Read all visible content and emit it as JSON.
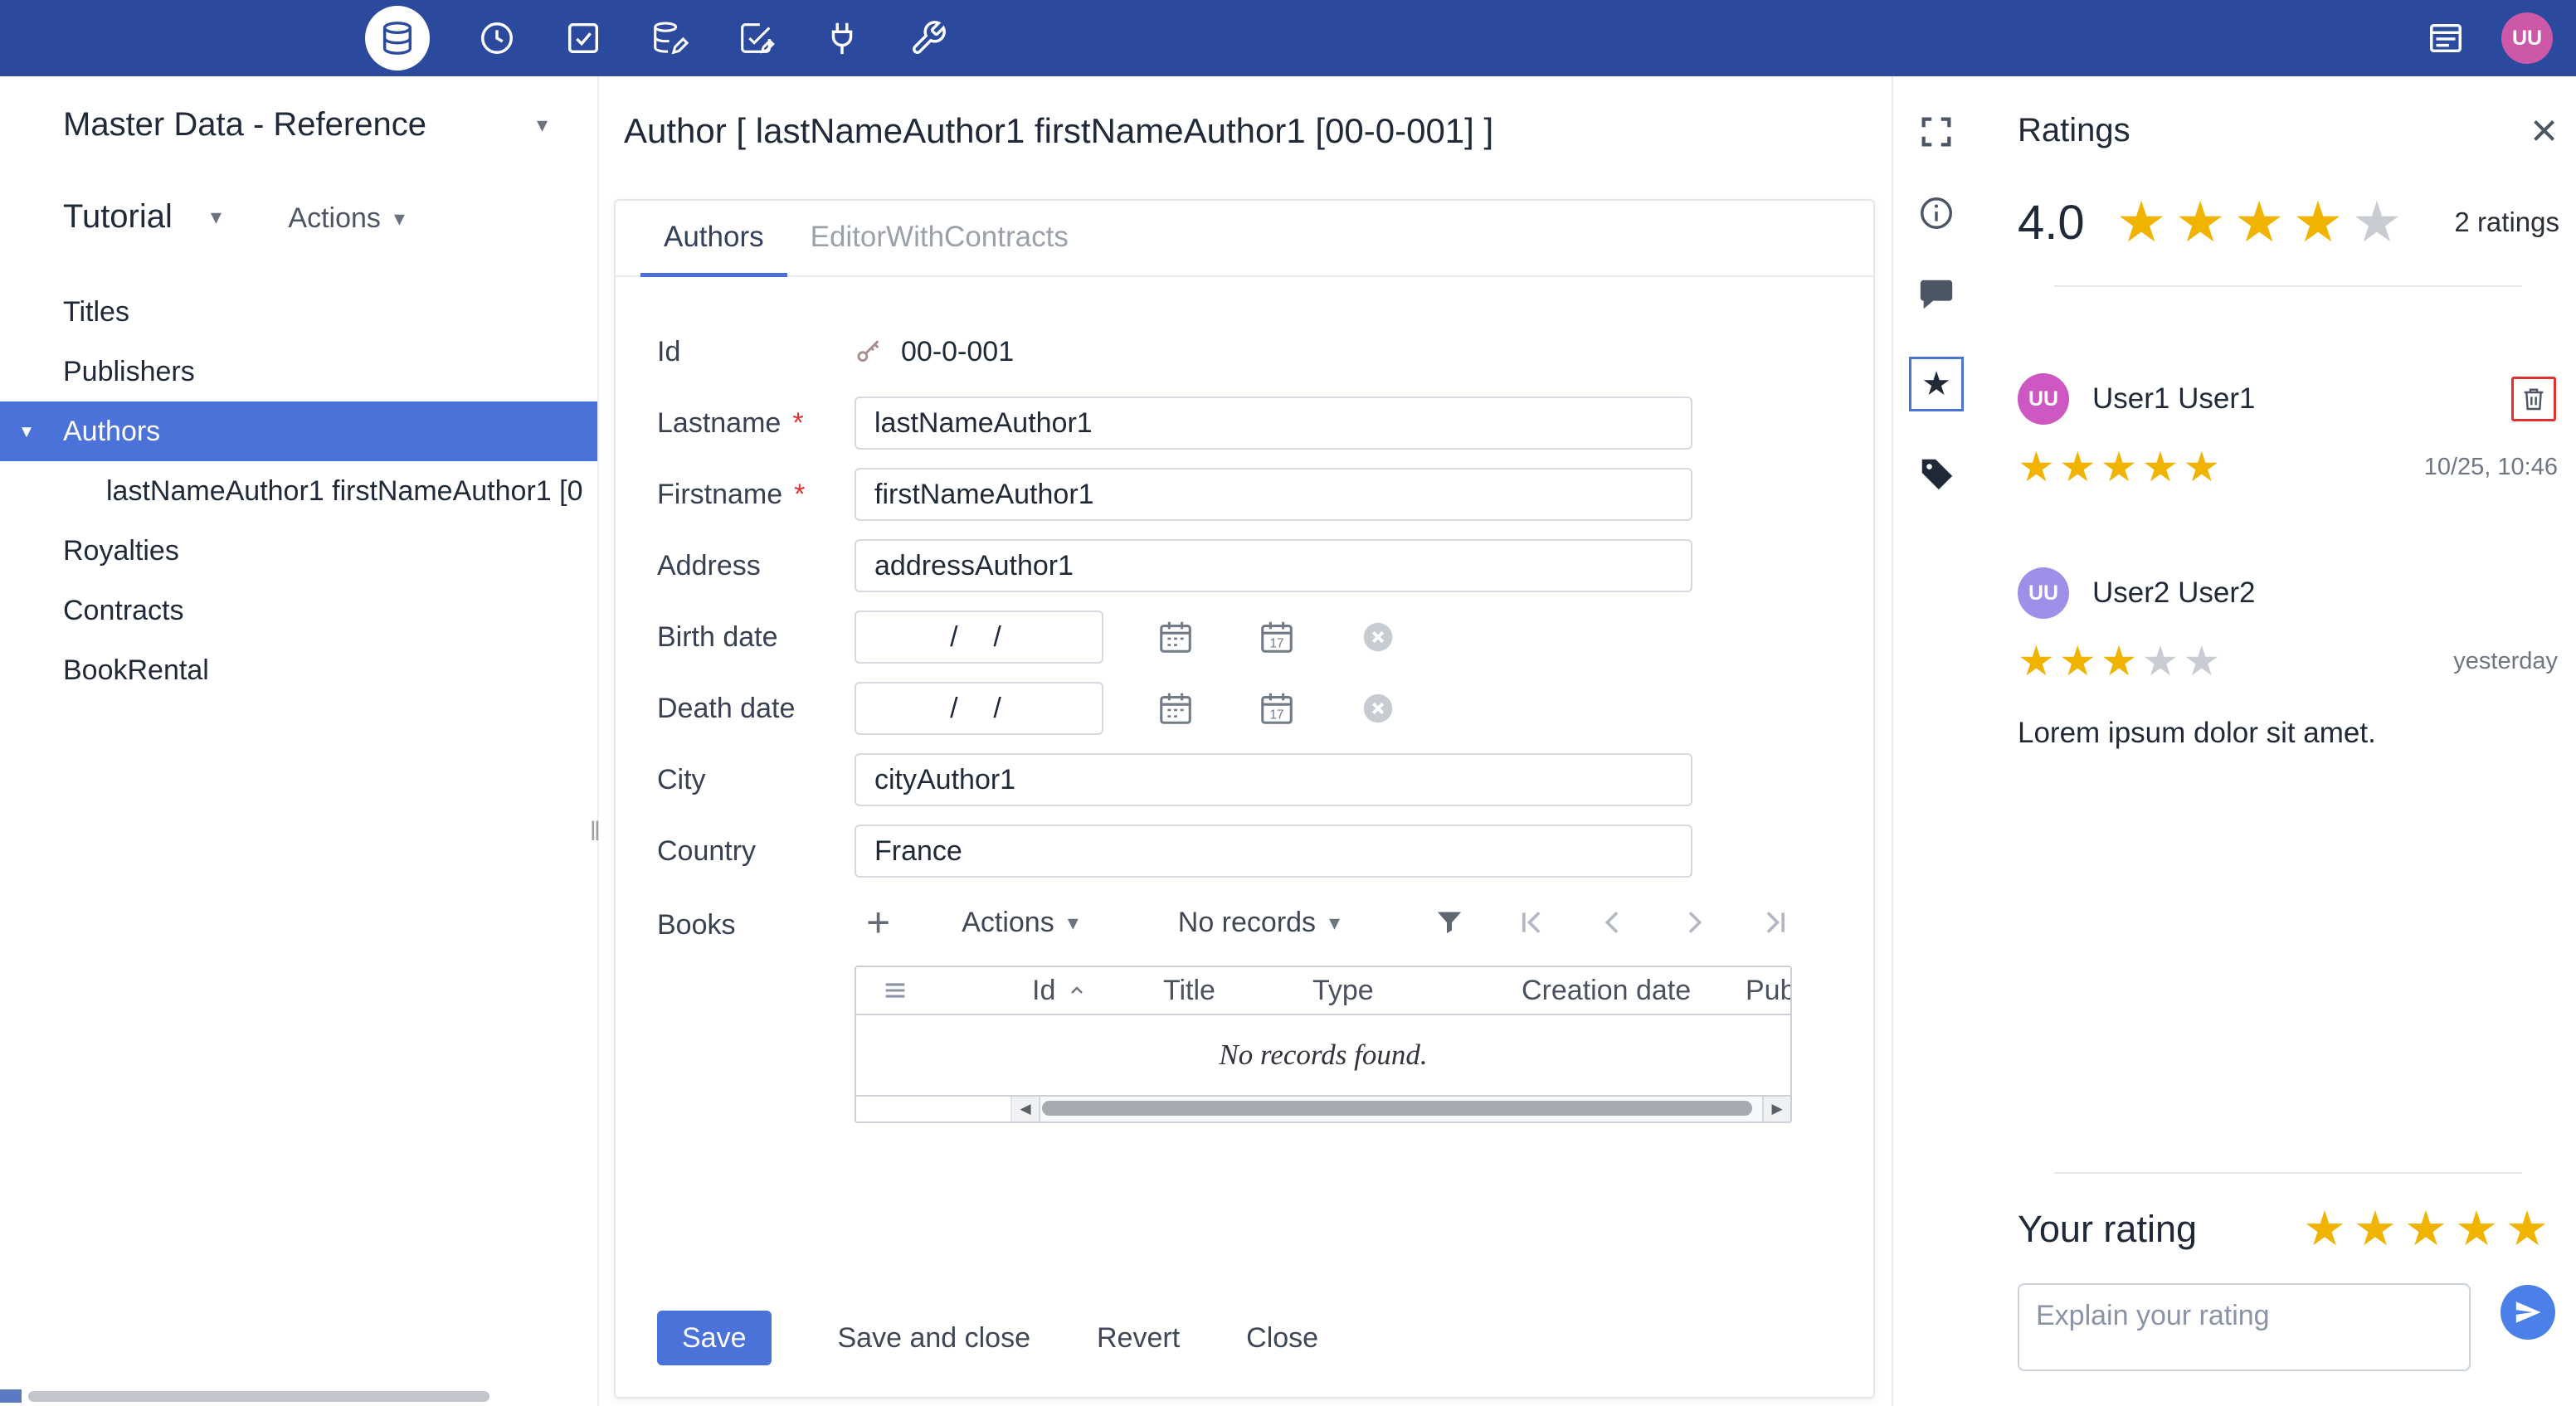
{
  "colors": {
    "topbar": "#2B4A9E",
    "accent": "#4A72D8",
    "star_filled": "#F0B400",
    "star_empty": "#C9CDD3",
    "danger": "#E03131",
    "avatar_top": "#CD58A8",
    "avatar_user1": "#CE58C2",
    "avatar_user2": "#9E8FE8"
  },
  "topbar": {
    "avatar": "UU"
  },
  "sidebar": {
    "workspace": "Master Data - Reference",
    "project": "Tutorial",
    "actions": "Actions",
    "items": [
      {
        "label": "Titles"
      },
      {
        "label": "Publishers"
      },
      {
        "label": "Authors"
      },
      {
        "label": "lastNameAuthor1 firstNameAuthor1 [0"
      },
      {
        "label": "Royalties"
      },
      {
        "label": "Contracts"
      },
      {
        "label": "BookRental"
      }
    ]
  },
  "main": {
    "title": "Author [ lastNameAuthor1 firstNameAuthor1 [00-0-001] ]",
    "tabs": {
      "authors": "Authors",
      "editor": "EditorWithContracts"
    },
    "form": {
      "required_mark": "*",
      "id_label": "Id",
      "id_value": "00-0-001",
      "lastname_label": "Lastname",
      "lastname_value": "lastNameAuthor1",
      "firstname_label": "Firstname",
      "firstname_value": "firstNameAuthor1",
      "address_label": "Address",
      "address_value": "addressAuthor1",
      "birth_label": "Birth date",
      "birth_value": "/  /",
      "death_label": "Death date",
      "death_value": "/  /",
      "city_label": "City",
      "city_value": "cityAuthor1",
      "country_label": "Country",
      "country_value": "France"
    },
    "books": {
      "label": "Books",
      "actions": "Actions",
      "paging": "No records",
      "columns": [
        "Id",
        "Title",
        "Type",
        "Creation date",
        "Publish"
      ],
      "empty": "No records found."
    },
    "footer": {
      "save": "Save",
      "save_close": "Save and close",
      "revert": "Revert",
      "close": "Close"
    }
  },
  "ratings": {
    "title": "Ratings",
    "average": "4.0",
    "average_stars": 4,
    "count": "2 ratings",
    "reviews": [
      {
        "initials": "UU",
        "name": "User1 User1",
        "stars": 5,
        "date": "10/25, 10:46",
        "comment": ""
      },
      {
        "initials": "UU",
        "name": "User2 User2",
        "stars": 3,
        "date": "yesterday",
        "comment": "Lorem ipsum dolor sit amet."
      }
    ],
    "your_rating": "Your rating",
    "your_stars": 5,
    "placeholder": "Explain your rating"
  }
}
